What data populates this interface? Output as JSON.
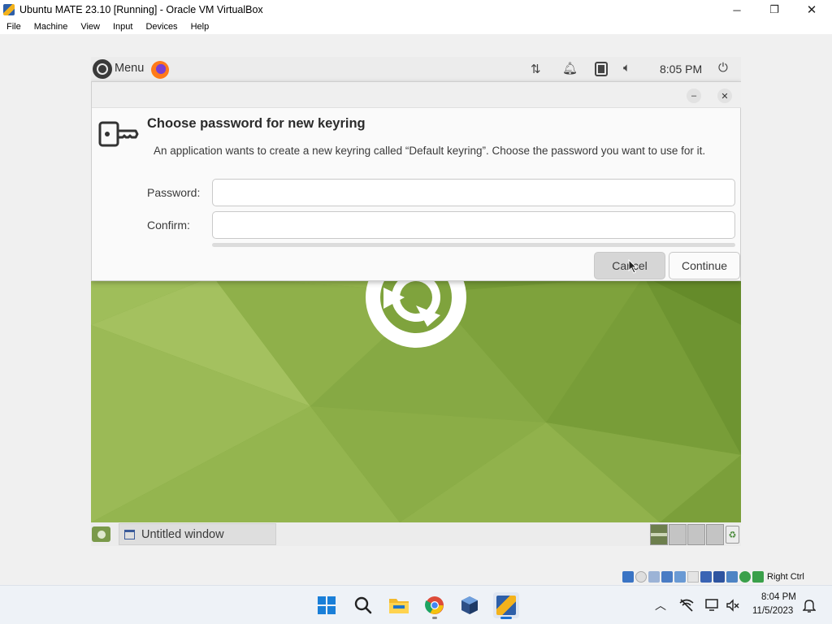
{
  "host": {
    "window_title": "Ubuntu MATE 23.10 [Running] - Oracle VM VirtualBox",
    "controls": {
      "minimize": "─",
      "maximize": "❐",
      "close": "✕"
    },
    "menu": [
      "File",
      "Machine",
      "View",
      "Input",
      "Devices",
      "Help"
    ],
    "status_bar": {
      "host_key": "Right Ctrl"
    }
  },
  "guest": {
    "top_panel": {
      "menu_label": "Menu",
      "clock": "8:05 PM"
    },
    "dialog": {
      "title": "Choose password for new keyring",
      "message": "An application wants to create a new keyring called “Default keyring”. Choose the password you want to use for it.",
      "password_label": "Password:",
      "password_value": "",
      "confirm_label": "Confirm:",
      "confirm_value": "",
      "cancel_label": "Cancel",
      "continue_label": "Continue",
      "minimize_glyph": "–",
      "close_glyph": "✕"
    },
    "bottom_panel": {
      "window_button_label": "Untitled window"
    }
  },
  "taskbar": {
    "clock_time": "8:04 PM",
    "clock_date": "11/5/2023"
  },
  "colors": {
    "wallpaper": "#7ea23b",
    "ubuntu_logo": "#ffffff",
    "workspace_active": "#6d7f4d"
  }
}
